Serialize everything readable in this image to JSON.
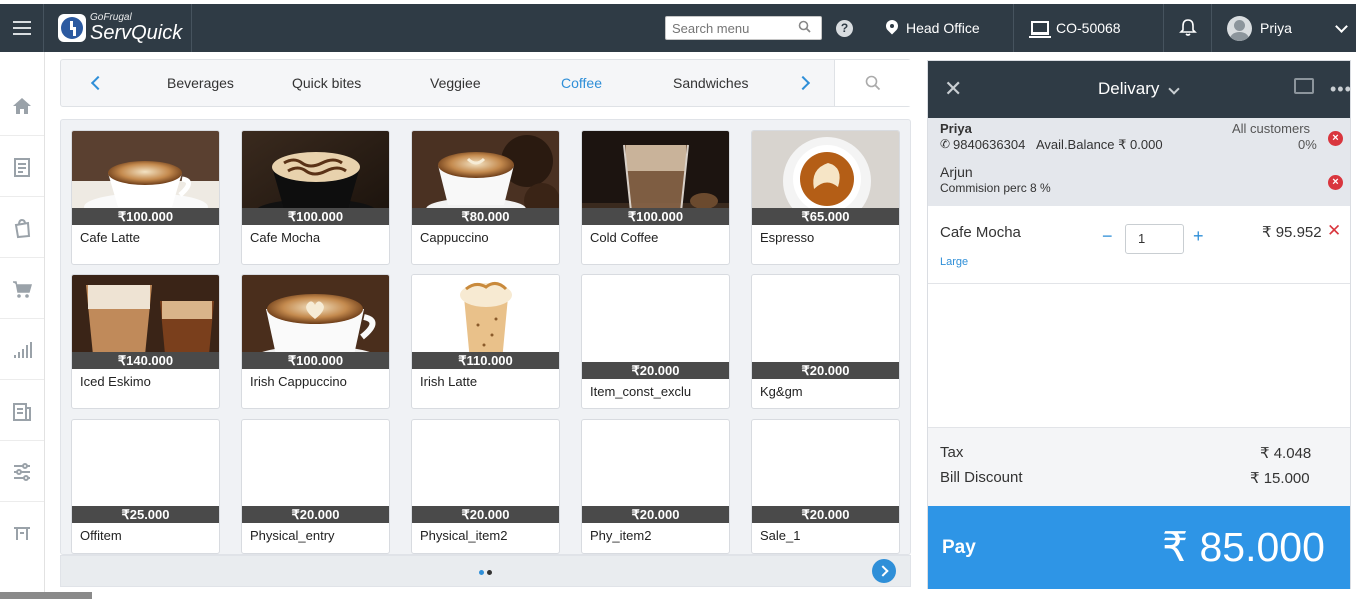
{
  "header": {
    "brand_small": "GoFrugal",
    "brand_name": "ServQuick",
    "search_placeholder": "Search menu",
    "location": "Head Office",
    "terminal": "CO-50068",
    "user": "Priya"
  },
  "sidebar": {
    "items": [
      {
        "icon": "home-icon"
      },
      {
        "icon": "orders-icon"
      },
      {
        "icon": "bag-icon"
      },
      {
        "icon": "cart-icon"
      },
      {
        "icon": "reports-icon"
      },
      {
        "icon": "register-icon"
      },
      {
        "icon": "settings-icon"
      },
      {
        "icon": "table-icon"
      }
    ]
  },
  "categories": {
    "items": [
      "Beverages",
      "Quick bites",
      "Veggiee",
      "Coffee",
      "Sandwiches"
    ],
    "active": "Coffee"
  },
  "products": [
    {
      "name": "Cafe Latte",
      "price": "₹100.000",
      "image": "latte"
    },
    {
      "name": "Cafe Mocha",
      "price": "₹100.000",
      "image": "mocha"
    },
    {
      "name": "Cappuccino",
      "price": "₹80.000",
      "image": "cappuccino"
    },
    {
      "name": "Cold Coffee",
      "price": "₹100.000",
      "image": "cold"
    },
    {
      "name": "Espresso",
      "price": "₹65.000",
      "image": "espresso"
    },
    {
      "name": "Iced Eskimo",
      "price": "₹140.000",
      "image": "iced"
    },
    {
      "name": "Irish Cappuccino",
      "price": "₹100.000",
      "image": "irishcap"
    },
    {
      "name": "Irish Latte",
      "price": "₹110.000",
      "image": "irishlatte"
    },
    {
      "name": "Item_const_exclu",
      "price": "₹20.000",
      "image": ""
    },
    {
      "name": "Kg&gm",
      "price": "₹20.000",
      "image": ""
    },
    {
      "name": "Offitem",
      "price": "₹25.000",
      "image": ""
    },
    {
      "name": "Physical_entry",
      "price": "₹20.000",
      "image": ""
    },
    {
      "name": "Physical_item2",
      "price": "₹20.000",
      "image": ""
    },
    {
      "name": "Phy_item2",
      "price": "₹20.000",
      "image": ""
    },
    {
      "name": "Sale_1",
      "price": "₹20.000",
      "image": ""
    }
  ],
  "pager": {
    "pages": 2,
    "current": 1
  },
  "order": {
    "type": "Delivary",
    "customer": {
      "name": "Priya",
      "phone": "9840636304",
      "balance": "Avail.Balance ₹ 0.000",
      "group": "All customers",
      "discount": "0%"
    },
    "agent": {
      "name": "Arjun",
      "commission": "Commision perc 8 %"
    },
    "lines": [
      {
        "name": "Cafe Mocha",
        "variant": "Large",
        "qty": "1",
        "price": "₹ 95.952"
      }
    ],
    "totals": {
      "tax_label": "Tax",
      "tax": "₹ 4.048",
      "discount_label": "Bill Discount",
      "discount": "₹ 15.000"
    },
    "pay_label": "Pay",
    "pay_amount": "₹ 85.000"
  },
  "colors": {
    "topbar": "#2f3b45",
    "accent": "#2f8fd8",
    "pay": "#2e95e6",
    "remove": "#d9363e"
  }
}
